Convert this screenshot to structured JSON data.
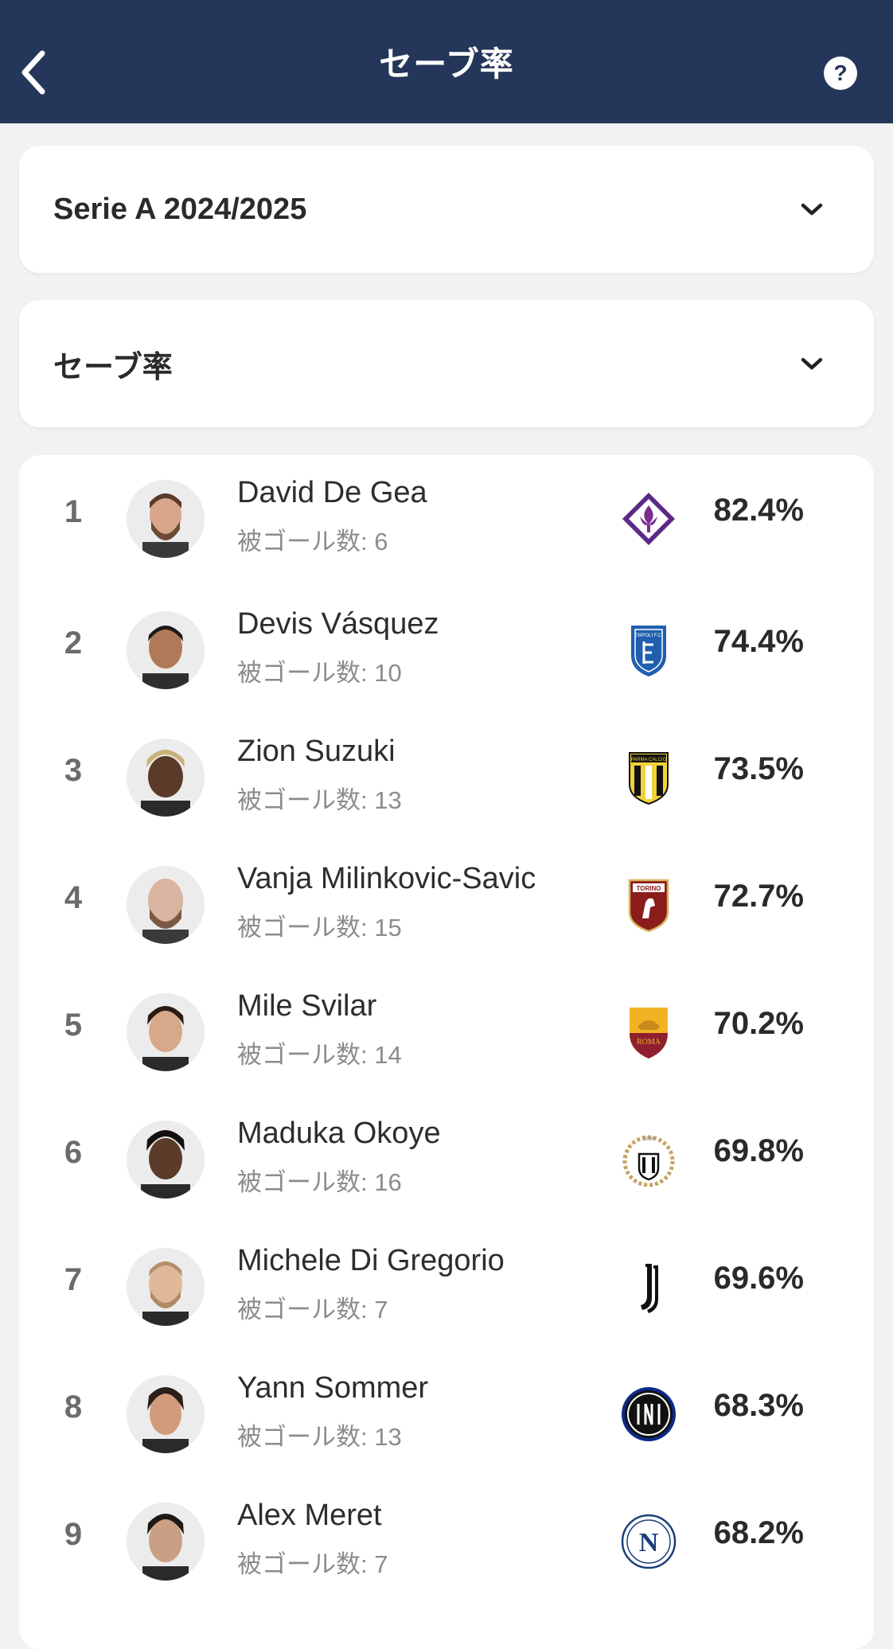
{
  "header": {
    "title": "セーブ率",
    "back_icon": "chevron-left-icon",
    "help_icon": "question-icon"
  },
  "league_selector": {
    "value": "Serie A 2024/2025",
    "icon": "chevron-down-icon"
  },
  "stat_selector": {
    "value": "セーブ率",
    "icon": "chevron-down-icon"
  },
  "colors": {
    "header_bg": "#243659",
    "page_bg": "#f2f2f4",
    "card_bg": "#ffffff"
  },
  "players": [
    {
      "rank": "1",
      "name": "David De Gea",
      "goals_conceded": "被ゴール数: 6",
      "club": "Fiorentina",
      "save_pct": "82.4%"
    },
    {
      "rank": "2",
      "name": "Devis Vásquez",
      "goals_conceded": "被ゴール数: 10",
      "club": "Empoli",
      "save_pct": "74.4%"
    },
    {
      "rank": "3",
      "name": "Zion Suzuki",
      "goals_conceded": "被ゴール数: 13",
      "club": "Parma",
      "save_pct": "73.5%"
    },
    {
      "rank": "4",
      "name": "Vanja Milinkovic-Savic",
      "goals_conceded": "被ゴール数: 15",
      "club": "Torino",
      "save_pct": "72.7%"
    },
    {
      "rank": "5",
      "name": "Mile Svilar",
      "goals_conceded": "被ゴール数: 14",
      "club": "Roma",
      "save_pct": "70.2%"
    },
    {
      "rank": "6",
      "name": "Maduka Okoye",
      "goals_conceded": "被ゴール数: 16",
      "club": "Udinese",
      "save_pct": "69.8%"
    },
    {
      "rank": "7",
      "name": "Michele Di Gregorio",
      "goals_conceded": "被ゴール数: 7",
      "club": "Juventus",
      "save_pct": "69.6%"
    },
    {
      "rank": "8",
      "name": "Yann Sommer",
      "goals_conceded": "被ゴール数: 13",
      "club": "Inter",
      "save_pct": "68.3%"
    },
    {
      "rank": "9",
      "name": "Alex Meret",
      "goals_conceded": "被ゴール数: 7",
      "club": "Napoli",
      "save_pct": "68.2%"
    }
  ],
  "crest_text": {
    "empoli": "EMPOLI F.C.",
    "parma": "PARMA CALCIO",
    "torino": "TORINO",
    "roma": "ROMA",
    "udinese": "1896",
    "napoli": "N"
  }
}
